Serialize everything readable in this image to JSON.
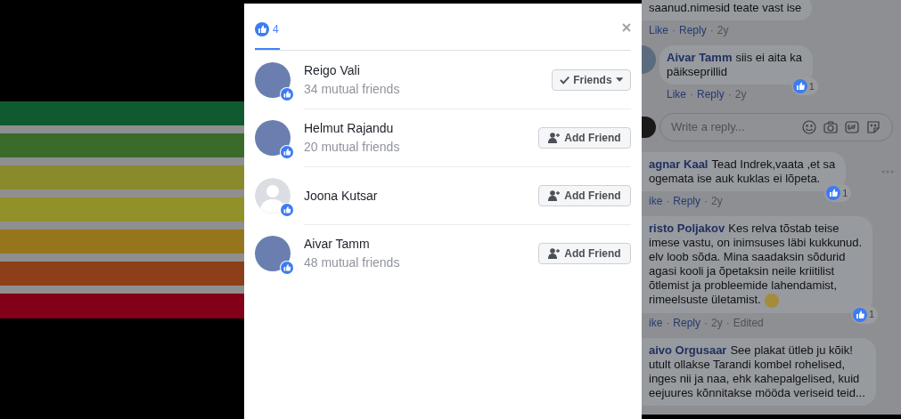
{
  "reactions_dialog": {
    "tabs": [
      {
        "kind": "like",
        "count": "4",
        "selected": true
      }
    ],
    "people": [
      {
        "name": "Reigo Vali",
        "mutual": "34 mutual friends",
        "avatar": {
          "kind": "photo"
        },
        "button": {
          "kind": "friends",
          "label": "Friends"
        }
      },
      {
        "name": "Helmut Rajandu",
        "mutual": "20 mutual friends",
        "avatar": {
          "kind": "photo"
        },
        "button": {
          "kind": "add",
          "label": "Add Friend"
        }
      },
      {
        "name": "Joona Kutsar",
        "avatar": {
          "kind": "silhouette"
        },
        "button": {
          "kind": "add",
          "label": "Add Friend"
        }
      },
      {
        "name": "Aivar Tamm",
        "mutual": "48 mutual friends",
        "avatar": {
          "kind": "photo"
        },
        "button": {
          "kind": "add",
          "label": "Add Friend"
        }
      }
    ]
  },
  "action_separator": "·",
  "comments": [
    {
      "kind": "comment",
      "lines": [
        "saanud.nimesid teate vast ise"
      ],
      "actions": [
        "Like",
        "Reply",
        "2y"
      ]
    },
    {
      "kind": "comment",
      "avatar": true,
      "author": "Aivar Tamm",
      "lines": [
        "siis ei aita ka",
        "päikseprillid"
      ],
      "actions": [
        "Like",
        "Reply",
        "2y"
      ],
      "likes": "1"
    },
    {
      "kind": "reply",
      "placeholder": "Write a reply..."
    },
    {
      "kind": "comment",
      "author": "agnar Kaal",
      "lines": [
        "Tead Indrek,vaata ,et sa",
        "ogemata ise auk kuklas ei lõpeta."
      ],
      "actions": [
        "ike",
        "Reply",
        "2y"
      ],
      "likes": "1",
      "more": true
    },
    {
      "kind": "comment",
      "author": "risto Poljakov",
      "lines": [
        "Kes relva tõstab teise",
        "imese vastu, on inimsuses läbi kukkunud.",
        "elv loob sõda. Mina saadaksin sõdurid",
        "agasi kooli ja õpetaksin neile kriitilist",
        "õtlemist ja probleemide lahendamist,",
        "rimeelsuste ületamist."
      ],
      "smiley": true,
      "actions": [
        "ike",
        "Reply",
        "2y",
        "Edited"
      ],
      "likes": "1"
    },
    {
      "kind": "comment",
      "author": "aivo Orgusaar",
      "lines": [
        "See plakat ütleb ju kõik!",
        "utult ollakse Tarandi kombel rohelised,",
        "inges nii ja naa, ehk kahepalgelised, kuid",
        "eejuures kõnnitakse mööda veriseid teid..."
      ]
    }
  ]
}
